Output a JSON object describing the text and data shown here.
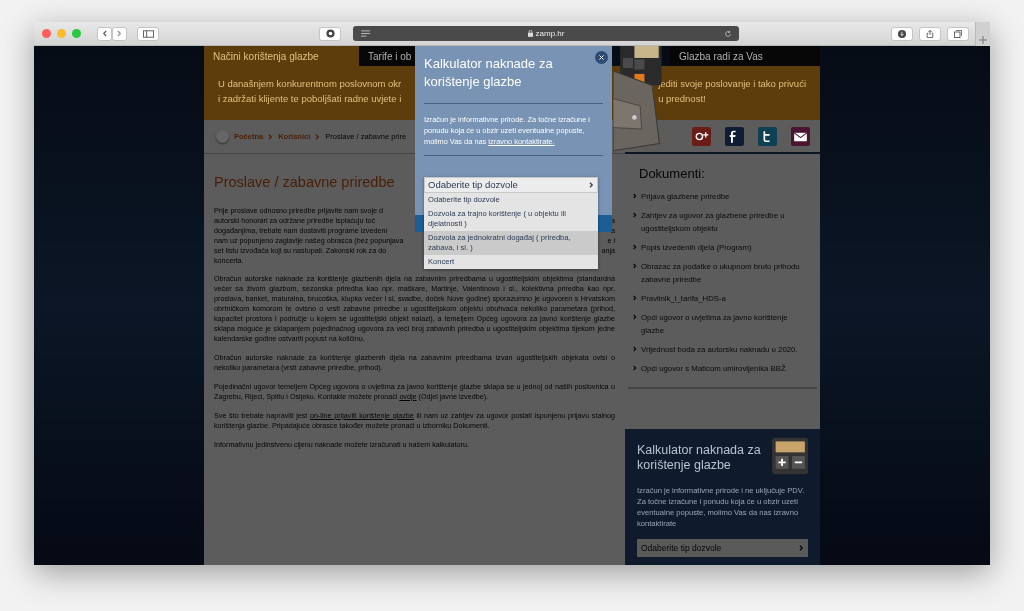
{
  "browser": {
    "url": "zamp.hr"
  },
  "nav": [
    {
      "label": "Načini korištenja glazbe",
      "selected": true
    },
    {
      "label": "Tarife i ob",
      "selected": false
    },
    {
      "label": "Glazba radi za Vas",
      "selected": false
    }
  ],
  "banner": {
    "left_lines": [
      "U današnjem konkurentnom poslovnom okr",
      "i zadržati klijente te poboljšati radne uvjete i"
    ],
    "right_lines": [
      "jediti svoje poslovanje i tako privući",
      "u prednost!"
    ]
  },
  "breadcrumb": [
    "Početna",
    "Korisnici",
    "Proslave / zabavne prire"
  ],
  "article": {
    "title": "Proslave / zabavne priredbe",
    "intro_lines": [
      {
        "left": "Prije proslave odnosno priredbe prijavite nam svoje d"
      },
      {
        "left": "autorski honorari za održane priredbe isplaćuju toč",
        "right": "a"
      },
      {
        "left": "događanjima, trebate nam dostaviti programe izvedeni",
        "right": "a"
      },
      {
        "left": "nam uz popunjeno zaglavlje našeg obrasca (bez popunjava",
        "right": "e i"
      },
      {
        "left": "set listu izvođača koji su nastupali. Zakonski rok za do",
        "right": "anja"
      },
      {
        "left": "koncerta."
      }
    ],
    "paragraphs": [
      [
        {
          "kind": "text",
          "text": "Obračun autorske naknade za korištenje glazbenih djela na zabavnim priredbama u ugostiteljskim objektima (standardna večer sa živom glazbom, sezonska priredba kao npr. maškare, Martinje, Valentinovo i sl., kolektivna priredba kao npr. proslava, banket, maturalna, brucoška, klupka večer i sl, svadbe, doček Nove godine) sporazumno je ugovoren s Hrvatskom obrtničkom komorom te ovisno o vrsti zabavne priredbe u ugostiteljskom objektu obuhvaća nekoliko parametara (prihod, kapacitet prostora i područje u kojem se ugostiteljski objekt nalazi), a temeljem Općeg ugovora za javno korištenje glazbe sklapa moguće je sklapanjem pojedinačnog ugovora za veći broj zabavnih priredba u ugostiteljskim objektima tijekom jedne kalendarske godine ostvariti popust na količinu."
        }
      ],
      [
        {
          "kind": "text",
          "text": "Obračun autorske naknade za korištenje glazbenih djela na zabavnim priredbama izvan ugostiteljskih objekata ovisi o nekoliko parametara (vrsti zabavne priredbe, prihod)."
        }
      ],
      [
        {
          "kind": "text",
          "text": "Pojedinačni ugovor temeljem Općeg ugovora o uvjetima za javno korištenje glazbe sklapa se u jednoj od naših poslovnica u Zagrebu, Rijeci, Splitu i Osijeku. Kontakte možete pronaći "
        },
        {
          "kind": "link",
          "text": "ovdje"
        },
        {
          "kind": "text",
          "text": " (Odjel javne izvedbe)."
        }
      ],
      [
        {
          "kind": "text",
          "text": "Sve što trebate napraviti jest "
        },
        {
          "kind": "link",
          "text": "on-line prijaviti korištenje glazbe"
        },
        {
          "kind": "text",
          "text": " ili nam uz zahtjev za ugovor poslati ispunjenu prijavu stalnog korištenja glazbe. Pripadajuće obrasce također možete pronaći u izborniku Dokumenti."
        }
      ],
      [
        {
          "kind": "text",
          "text": "Informativnu jedinstvenu cijenu naknade možete izračunati u našem kalkulatoru."
        }
      ]
    ]
  },
  "social": [
    {
      "kind": "gplus",
      "color": "#6a1c16"
    },
    {
      "kind": "facebook",
      "color": "#0e1c36"
    },
    {
      "kind": "twitter",
      "color": "#0c4052"
    },
    {
      "kind": "mail",
      "color": "#4a1432"
    }
  ],
  "documents": {
    "title": "Dokumenti:",
    "items": [
      "Prijava glazbene priredbe",
      "Zahtjev za ugovor za glazbene priredbe u ugostiteljskom objektu",
      "Popis izvedenih djela (Program)",
      "Obrazac za podatke o ukupnom bruto prihodu zabavne priredbe",
      "Pravilnik_i_tarifa_HDS-a",
      "Opći ugovor o uvjetima za javno korištenje glazbe",
      "Vrijednost boda za autorsku naknadu u 2020.",
      "Opći ugovor s Maticom umirovljenika BBŽ"
    ]
  },
  "calculator_widget": {
    "title": "Kalkulator naknada za korištenje glazbe",
    "text": "Izračun je informativne prirode i ne uključuje PDV. Za točne izračune i ponudu koja će u obzir uzeti eventualne popuste, molimo Vas da nas izravno kontaktirate",
    "select": "Odaberite tip dozvole"
  },
  "modal": {
    "title": "Kalkulator naknade za korištenje glazbe",
    "text": "Izračun je informativne prirode. Za točne izračune i ponudu koja će u obzir uzeti eventualne popuste, molimo Vas da nas ",
    "link": "izravno kontaktirate.",
    "select": "Odaberite tip dozvole",
    "options": [
      {
        "label": "Odaberite tip dozvole",
        "highlighted": false
      },
      {
        "label": "Dozvola za trajno korištenje ( u objektu ili djelatnosti )",
        "highlighted": false
      },
      {
        "label": "Dozvola za jednokratni događaj ( priredba, zabava, i sl. )",
        "highlighted": true
      },
      {
        "label": "Koncert",
        "highlighted": false
      }
    ]
  }
}
